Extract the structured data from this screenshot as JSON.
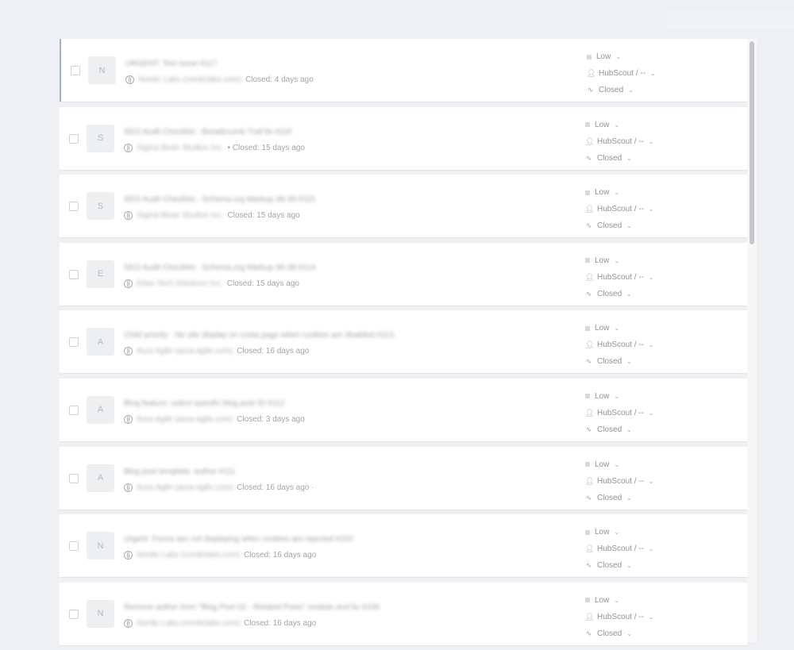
{
  "tickets": [
    {
      "initial": "N",
      "title": "URGENT: Test issue #117",
      "site": "Nordic Labs (nordiclabs.com)",
      "closed": "Closed: 4 days ago",
      "priority": "Low",
      "assignee": "HubScout / --",
      "status": "Closed",
      "active": true
    },
    {
      "initial": "S",
      "title": "SEO Audit Checklist - Breadcrumb Trail fix #116",
      "site": "Sigma Bean Studios Inc.",
      "closed": "• Closed: 15 days ago",
      "priority": "Low",
      "assignee": "HubScout / --",
      "status": "Closed"
    },
    {
      "initial": "S",
      "title": "SEO Audit Checklist - Schema.org Markup 38-39 #115",
      "site": "Sigma Bean Studios Inc.",
      "closed": "Closed: 15 days ago",
      "priority": "Low",
      "assignee": "HubScout / --",
      "status": "Closed"
    },
    {
      "initial": "E",
      "title": "SEO Audit Checklist - Schema.org Markup 36-38 #114",
      "site": "Etlas Tech Solutions Inc.",
      "closed": "Closed: 15 days ago",
      "priority": "Low",
      "assignee": "HubScout / --",
      "status": "Closed"
    },
    {
      "initial": "A",
      "title": "Child priority - No site display on costa page when cookies are disabled #113",
      "site": "Aura Agile (aura-agile.com)",
      "closed": "Closed: 16 days ago",
      "priority": "Low",
      "assignee": "HubScout / --",
      "status": "Closed"
    },
    {
      "initial": "A",
      "title": "Blog feature: select specific blog post ID #112",
      "site": "Aura Agile (aura-agile.com)",
      "closed": "Closed: 3 days ago",
      "priority": "Low",
      "assignee": "HubScout / --",
      "status": "Closed"
    },
    {
      "initial": "A",
      "title": "Blog post template: author #111",
      "site": "Aura Agile (aura-agile.com)",
      "closed": "Closed: 16 days ago ·",
      "priority": "Low",
      "assignee": "HubScout / --",
      "status": "Closed"
    },
    {
      "initial": "N",
      "title": "Urgent: Forms are not displaying when cookies are rejected #110",
      "site": "Nordic Labs (nordiclabs.com)",
      "closed": "Closed: 16 days ago",
      "priority": "Low",
      "assignee": "HubScout / --",
      "status": "Closed"
    },
    {
      "initial": "N",
      "title": "Remove author from \"Blog Post 02 - Related Posts\" module and fix #109",
      "site": "Nordic Labs (nordiclabs.com)",
      "closed": "Closed: 16 days ago",
      "priority": "Low",
      "assignee": "HubScout / --",
      "status": "Closed"
    }
  ]
}
